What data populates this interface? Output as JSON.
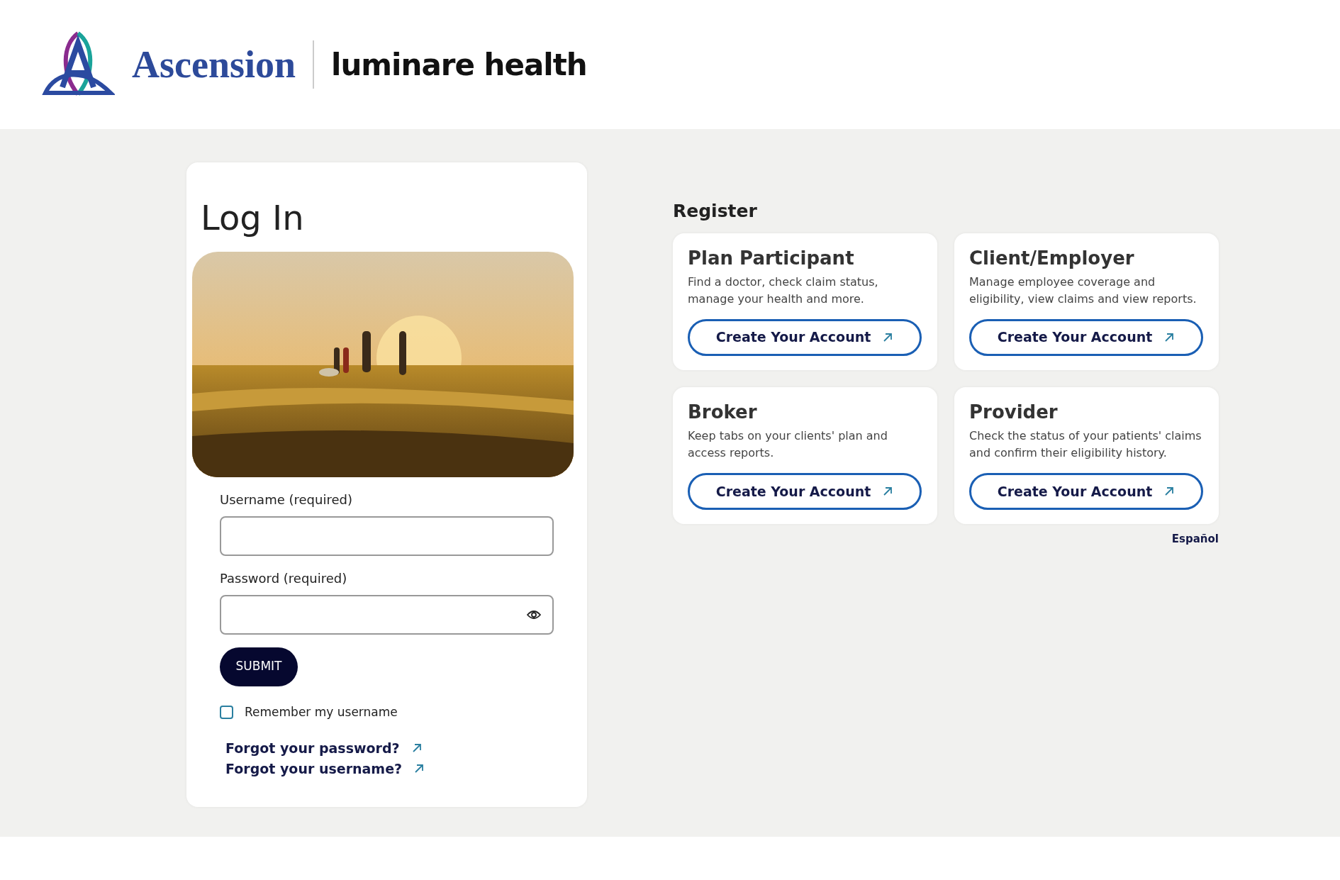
{
  "header": {
    "logo_text": "Ascension",
    "brand_text": "luminare health"
  },
  "login": {
    "title": "Log In",
    "fields": [
      {
        "label": "Username (required)",
        "kind": "text"
      },
      {
        "label": "Password (required)",
        "kind": "password"
      }
    ],
    "submit": "SUBMIT",
    "remember": {
      "label": "Remember my username",
      "checked": false
    },
    "links": [
      "Forgot your password?",
      "Forgot your username?"
    ]
  },
  "register": {
    "title": "Register",
    "cards": [
      {
        "title": "Plan Participant",
        "description": "Find a doctor, check claim status, manage your health and more.",
        "button": "Create Your Account"
      },
      {
        "title": "Client/Employer",
        "description": "Manage employee coverage and eligibility, view claims and view reports.",
        "button": "Create Your Account"
      },
      {
        "title": "Broker",
        "description": "Keep tabs on your clients' plan and access reports.",
        "button": "Create Your Account"
      },
      {
        "title": "Provider",
        "description": "Check the status of your patients' claims and confirm their eligibility history.",
        "button": "Create Your Account"
      }
    ]
  },
  "language_link": "Español"
}
